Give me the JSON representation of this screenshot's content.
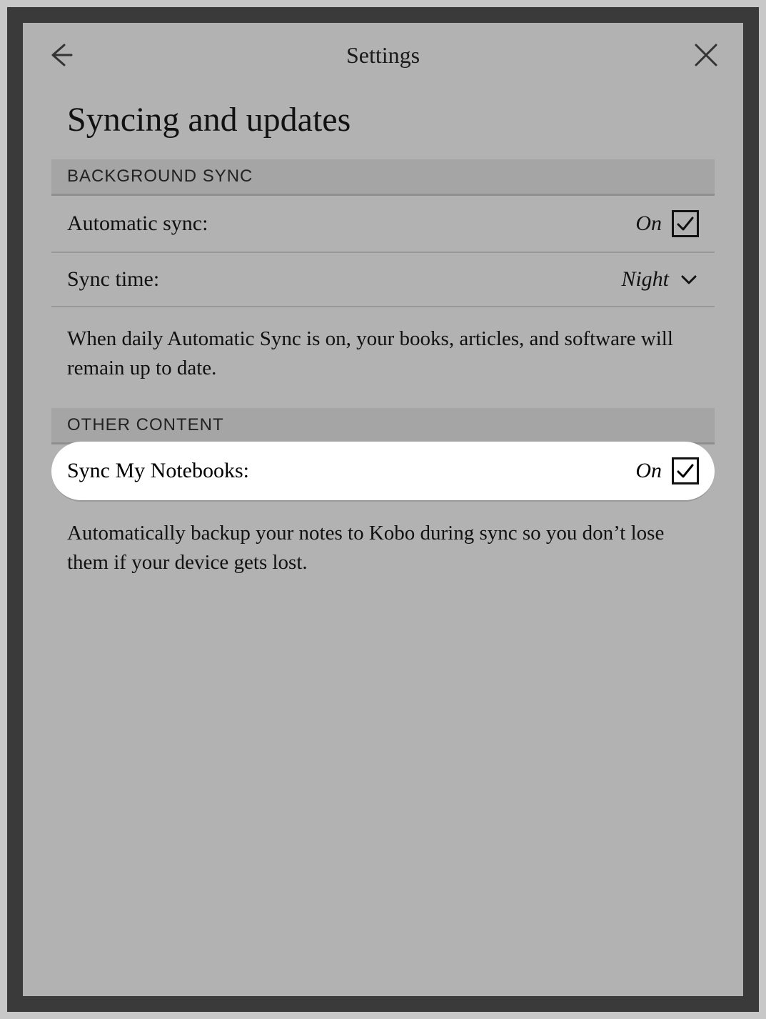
{
  "header": {
    "title": "Settings"
  },
  "page": {
    "title": "Syncing and updates"
  },
  "sections": {
    "background_sync": {
      "header": "BACKGROUND SYNC",
      "automatic_sync": {
        "label": "Automatic sync:",
        "value": "On"
      },
      "sync_time": {
        "label": "Sync time:",
        "value": "Night"
      },
      "description": "When daily Automatic Sync is on, your books, articles, and software will remain up to date."
    },
    "other_content": {
      "header": "OTHER CONTENT",
      "sync_notebooks": {
        "label": "Sync My Notebooks:",
        "value": "On"
      },
      "description": "Automatically backup your notes to Kobo during sync so you don’t lose them if your device gets lost."
    }
  }
}
